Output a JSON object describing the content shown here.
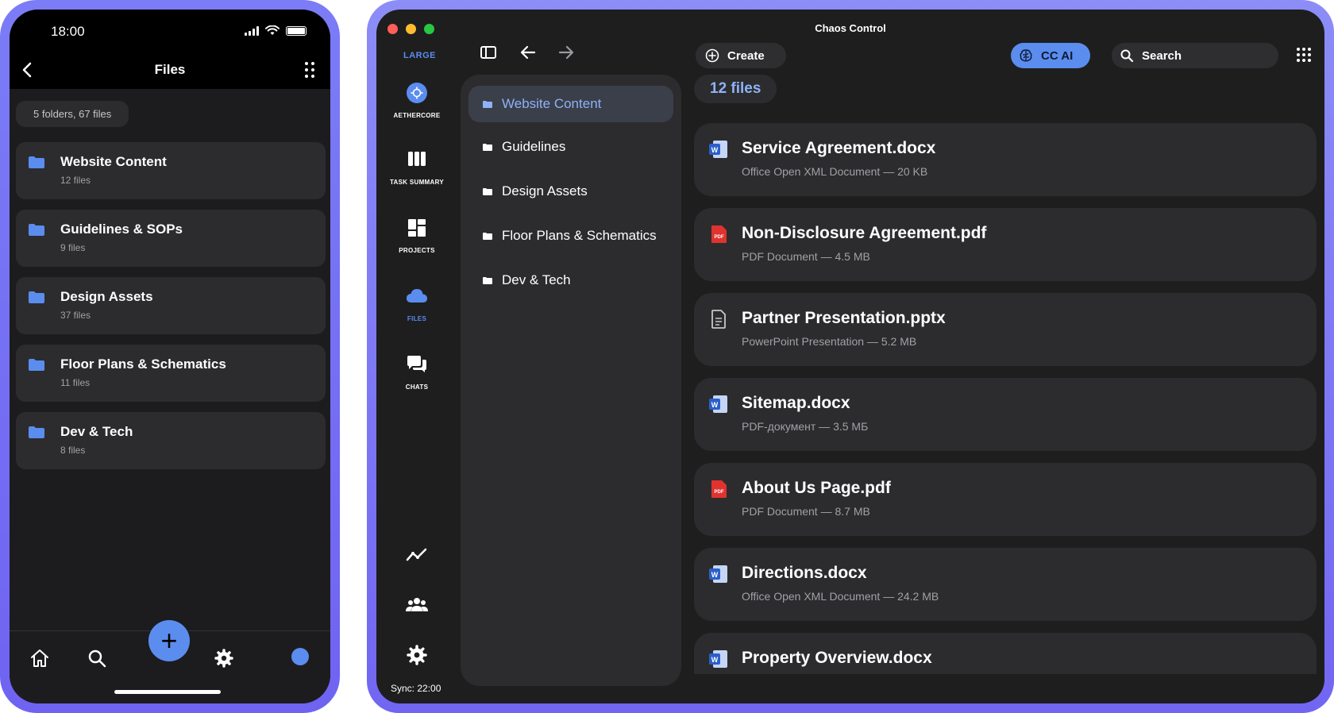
{
  "phone": {
    "time": "18:00",
    "title": "Files",
    "summary": "5 folders, 67 files",
    "folders": [
      {
        "name": "Website Content",
        "count": "12 files"
      },
      {
        "name": "Guidelines & SOPs",
        "count": "9 files"
      },
      {
        "name": "Design Assets",
        "count": "37 files"
      },
      {
        "name": "Floor Plans & Schematics",
        "count": "11 files"
      },
      {
        "name": "Dev & Tech",
        "count": "8 files"
      }
    ],
    "fab_label": "+"
  },
  "desktop": {
    "window_title": "Chaos Control",
    "size_label": "LARGE",
    "rail": [
      {
        "label": "AETHERCORE",
        "icon": "aethercore-icon"
      },
      {
        "label": "TASK SUMMARY",
        "icon": "task-summary-icon"
      },
      {
        "label": "PROJECTS",
        "icon": "projects-icon"
      },
      {
        "label": "FILES",
        "icon": "cloud-icon"
      },
      {
        "label": "CHATS",
        "icon": "chats-icon"
      }
    ],
    "sync": "Sync: 22:00",
    "create_label": "Create",
    "ai_label": "CC AI",
    "search_label": "Search",
    "folders": [
      {
        "name": "Website Content"
      },
      {
        "name": "Guidelines"
      },
      {
        "name": "Design Assets"
      },
      {
        "name": "Floor Plans & Schematics"
      },
      {
        "name": "Dev & Tech"
      }
    ],
    "file_count": "12 files",
    "files": [
      {
        "name": "Service Agreement.docx",
        "meta": "Office Open XML Document — 20 KB",
        "type": "word"
      },
      {
        "name": "Non-Disclosure Agreement.pdf",
        "meta": "PDF Document — 4.5 MB",
        "type": "pdf"
      },
      {
        "name": "Partner Presentation.pptx",
        "meta": "PowerPoint Presentation — 5.2 MB",
        "type": "generic"
      },
      {
        "name": "Sitemap.docx",
        "meta": "PDF-документ — 3.5 МБ",
        "type": "word"
      },
      {
        "name": "About Us Page.pdf",
        "meta": "PDF Document — 8.7 MB",
        "type": "pdf"
      },
      {
        "name": "Directions.docx",
        "meta": "Office Open XML Document — 24.2 MB",
        "type": "word"
      },
      {
        "name": "Property Overview.docx",
        "meta": "",
        "type": "word"
      }
    ],
    "colors": {
      "accent": "#5b8def",
      "card": "#2c2c2e",
      "bg": "#1e1e1f"
    }
  }
}
